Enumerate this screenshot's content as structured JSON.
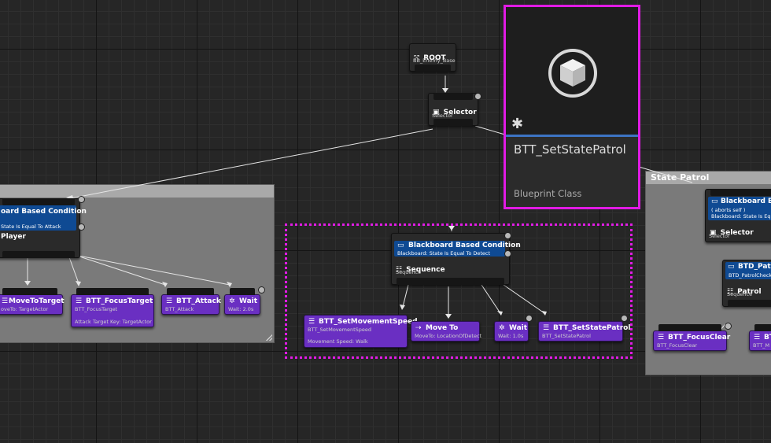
{
  "root_node": {
    "title": "ROOT",
    "subtitle": "BB_Enemy_Base",
    "icon": "root-icon"
  },
  "top_selector": {
    "title": "Selector",
    "subtitle": "Selector",
    "icon": "selector-icon"
  },
  "asset_tooltip": {
    "name": "BTT_SetStatePatrol",
    "type": "Blueprint Class",
    "icon": "blueprint-cube-icon",
    "badge": "✱"
  },
  "left_group": {
    "decorator_title": "oard Based Condition",
    "decorator_sub": "State Is Equal To Attack",
    "sequence_title": "Player",
    "tasks": [
      {
        "title": "MoveToTarget",
        "sub": "oveTo: TargetActor"
      },
      {
        "title": "BTT_FocusTarget",
        "sub": "BTT_FocusTarget",
        "extra": "Attack Target Key: TargetActor"
      },
      {
        "title": "BTT_Attack",
        "sub": "BTT_Attack"
      },
      {
        "title": "Wait",
        "sub": "Wait: 2.0s"
      }
    ]
  },
  "center_group": {
    "decorator_title": "Blackboard Based Condition",
    "decorator_sub": "Blackboard: State Is Equal To Detect",
    "sequence_title": "Sequence",
    "sequence_sub": "Sequence",
    "tasks": [
      {
        "title": "BTT_SetMovementSpeed",
        "sub": "BTT_SetMovementSpeed",
        "extra": "Movement Speed: Walk"
      },
      {
        "title": "Move To",
        "sub": "MoveTo: LocationOfDetect"
      },
      {
        "title": "Wait",
        "sub": "Wait: 1.0s"
      },
      {
        "title": "BTT_SetStatePatrol",
        "sub": "BTT_SetStatePatrol"
      }
    ]
  },
  "right_group": {
    "comment_title": "State Patrol",
    "decorator_title": "Blackboard Bas",
    "decorator_sub1": "( aborts self )",
    "decorator_sub2": "Blackboard: State Is Eq",
    "selector_title": "Selector",
    "selector_sub": "Selector",
    "service_title": "BTD_Patro",
    "service_sub": "BTD_PatrolCheck",
    "patrol_title": "Patrol",
    "patrol_sub": "Sequence",
    "tasks": [
      {
        "title": "BTT_FocusClear",
        "sub": "BTT_FocusClear"
      },
      {
        "title": "BT",
        "sub": "BTT_M"
      }
    ]
  },
  "colors": {
    "task": "#6a2fc2",
    "decorator": "#0f4a93",
    "selection": "#e11be5",
    "comment": "#7a7a7a"
  }
}
